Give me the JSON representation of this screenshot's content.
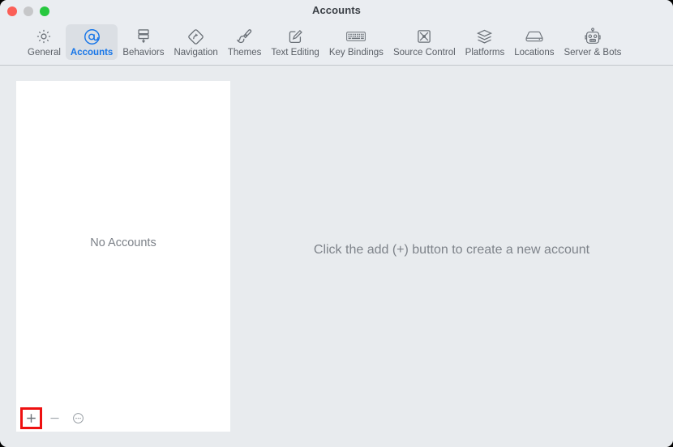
{
  "window": {
    "title": "Accounts",
    "controls": [
      {
        "name": "close",
        "color": "#fb5f57"
      },
      {
        "name": "minimize",
        "color": "#c6c7c9"
      },
      {
        "name": "maximize",
        "color": "#27c83f"
      }
    ]
  },
  "toolbar": {
    "selected": "Accounts",
    "accent_color": "#1675e8",
    "items": [
      {
        "label": "General",
        "icon": "gear-icon"
      },
      {
        "label": "Accounts",
        "icon": "at-sign-icon"
      },
      {
        "label": "Behaviors",
        "icon": "behaviors-icon"
      },
      {
        "label": "Navigation",
        "icon": "navigation-diamond-arrow-icon"
      },
      {
        "label": "Themes",
        "icon": "paintbrush-icon"
      },
      {
        "label": "Text Editing",
        "icon": "pencil-square-icon"
      },
      {
        "label": "Key Bindings",
        "icon": "keyboard-icon"
      },
      {
        "label": "Source Control",
        "icon": "source-control-icon"
      },
      {
        "label": "Platforms",
        "icon": "layers-icon"
      },
      {
        "label": "Locations",
        "icon": "harddisk-icon"
      },
      {
        "label": "Server & Bots",
        "icon": "robot-icon"
      }
    ]
  },
  "sidebar": {
    "empty_label": "No Accounts",
    "footer": {
      "add_label": "+",
      "add_icon": "plus-icon",
      "remove_label": "–",
      "remove_icon": "minus-icon",
      "options_icon": "ellipsis-circle-icon",
      "add_highlight_color": "#ee1111"
    }
  },
  "detail": {
    "message": "Click the add (+) button to create a new account"
  }
}
